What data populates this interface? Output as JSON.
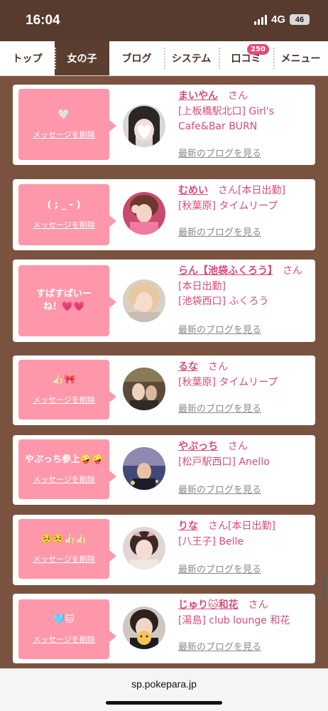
{
  "status": {
    "time": "16:04",
    "network": "4G",
    "battery": "46"
  },
  "nav": {
    "items": [
      {
        "label": "トップ",
        "active": false
      },
      {
        "label": "女の子",
        "active": true
      },
      {
        "label": "ブログ",
        "active": false
      },
      {
        "label": "システム",
        "active": false
      },
      {
        "label": "口コミ",
        "active": false,
        "badge": "250"
      },
      {
        "label": "メニュー",
        "active": false
      }
    ]
  },
  "common": {
    "delete_label": "メッセージを削除",
    "blog_link": "最新のブログを見る",
    "san": "さん"
  },
  "messages": [
    {
      "message": "🤍",
      "name": "まいやん",
      "suffix": "",
      "shop_line1": "[上板橋駅北口] Girl's",
      "shop_line2": "Cafe&Bar BURN"
    },
    {
      "message": "( ; _ - )",
      "name": "むめい",
      "suffix": "[本日出勤]",
      "shop_line1": "[秋葉原] タイムリープ",
      "shop_line2": ""
    },
    {
      "message": "すぱすぱいーね！💗💗",
      "name": "らん【池袋ふくろう】",
      "suffix": "[本日出勤]",
      "shop_line1": "[池袋西口] ふくろう",
      "shop_line2": ""
    },
    {
      "message": "👍🏻🎀",
      "name": "るな",
      "suffix": "",
      "shop_line1": "[秋葉原] タイムリープ",
      "shop_line2": ""
    },
    {
      "message": "やぷっち参上🤪🤪",
      "name": "やぷっち",
      "suffix": "",
      "shop_line1": "[松戸駅西口] Anello",
      "shop_line2": ""
    },
    {
      "message": "🥺🥺👍🏻👍🏻",
      "name": "りな",
      "suffix": "[本日出勤]",
      "shop_line1": "[八王子] Belle",
      "shop_line2": ""
    },
    {
      "message": "🩵🐱",
      "name": "じゅり🐱和花",
      "suffix": "",
      "shop_line1": "[湯島] club lounge 和花",
      "shop_line2": ""
    }
  ],
  "browser": {
    "url": "sp.pokepara.jp"
  }
}
